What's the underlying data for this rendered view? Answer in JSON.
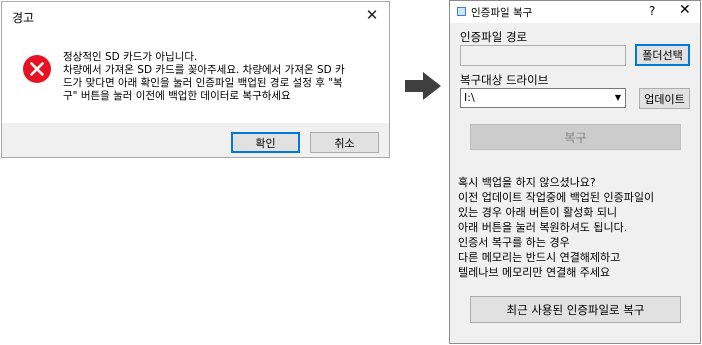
{
  "warning_dialog": {
    "title": "경고",
    "message": "정상적인 SD 카드가 아닙니다.\n차량에서 가져온 SD 카드를 꽂아주세요. 차량에서 가져온 SD 카\n드가 맞다면 아래 확인을 눌러 인증파일 백업된 경로 설정 후 \"복\n구\" 버튼을 눌러 이전에 백업한 데이터로 복구하세요",
    "ok_label": "확인",
    "cancel_label": "취소",
    "error_color": "#e81123"
  },
  "restore_window": {
    "title": "인증파일 복구",
    "help_label": "?",
    "close_label": "✕",
    "cert_path_label": "인증파일 경로",
    "cert_path_value": "",
    "folder_button_label": "폴더선택",
    "target_drive_label": "복구대상 드라이브",
    "drive_value": "I:\\",
    "update_button_label": "업데이트",
    "restore_button_label": "복구",
    "info_text": "혹시 백업을 하지 않으셨나요?\n이전 업데이트 작업중에 백업된 인증파일이\n있는 경우 아래 버튼이 활성화 되니\n아래 버튼을 눌러 복원하셔도 됩니다.\n인증서 복구를 하는 경우\n다른 메모리는 반드시 연결해제하고\n텔레나브 메모리만 연결해 주세요",
    "recent_button_label": "최근 사용된 인증파일로 복구"
  }
}
